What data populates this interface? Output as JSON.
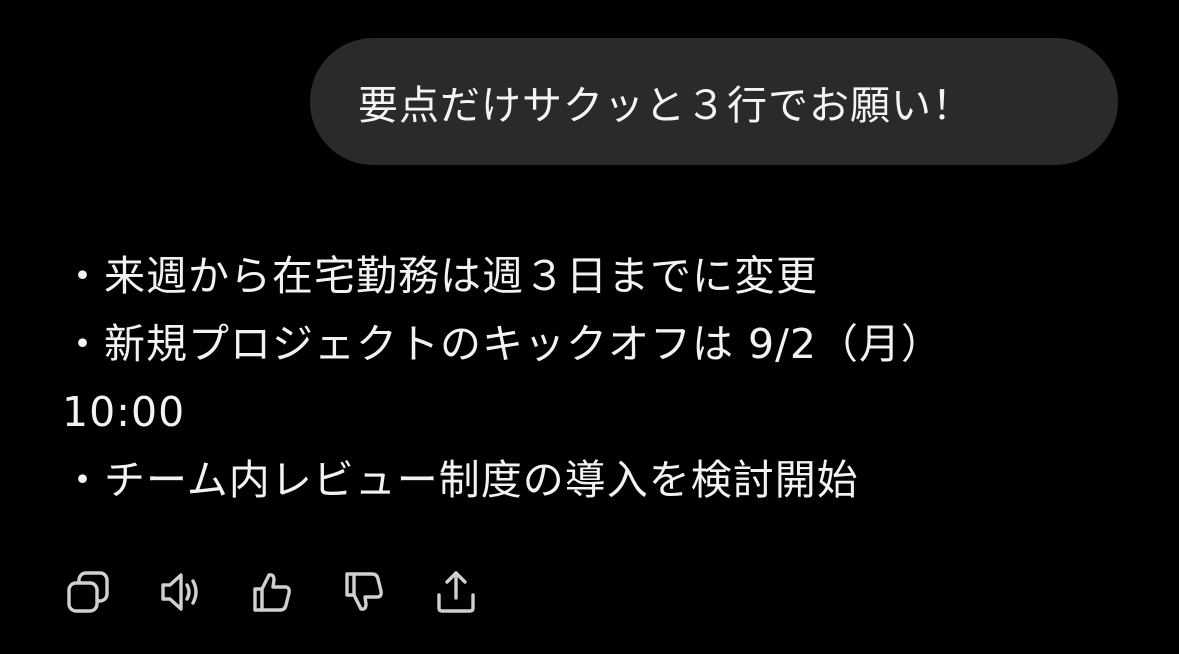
{
  "user_message": {
    "text": "要点だけサクッと３行でお願い！"
  },
  "assistant_message": {
    "lines": [
      "・来週から在宅勤務は週３日までに変更",
      "・新規プロジェクトのキックオフは 9/2（月）",
      "10:00",
      "・チーム内レビュー制度の導入を検討開始"
    ]
  },
  "actions": [
    {
      "name": "copy",
      "icon": "copy-icon"
    },
    {
      "name": "read-aloud",
      "icon": "speaker-icon"
    },
    {
      "name": "thumbs-up",
      "icon": "thumbs-up-icon"
    },
    {
      "name": "thumbs-down",
      "icon": "thumbs-down-icon"
    },
    {
      "name": "share",
      "icon": "share-icon"
    }
  ],
  "colors": {
    "background": "#000000",
    "bubble": "#2a2a2a",
    "text": "#f2f2f2",
    "icon": "#d0d0d0"
  }
}
